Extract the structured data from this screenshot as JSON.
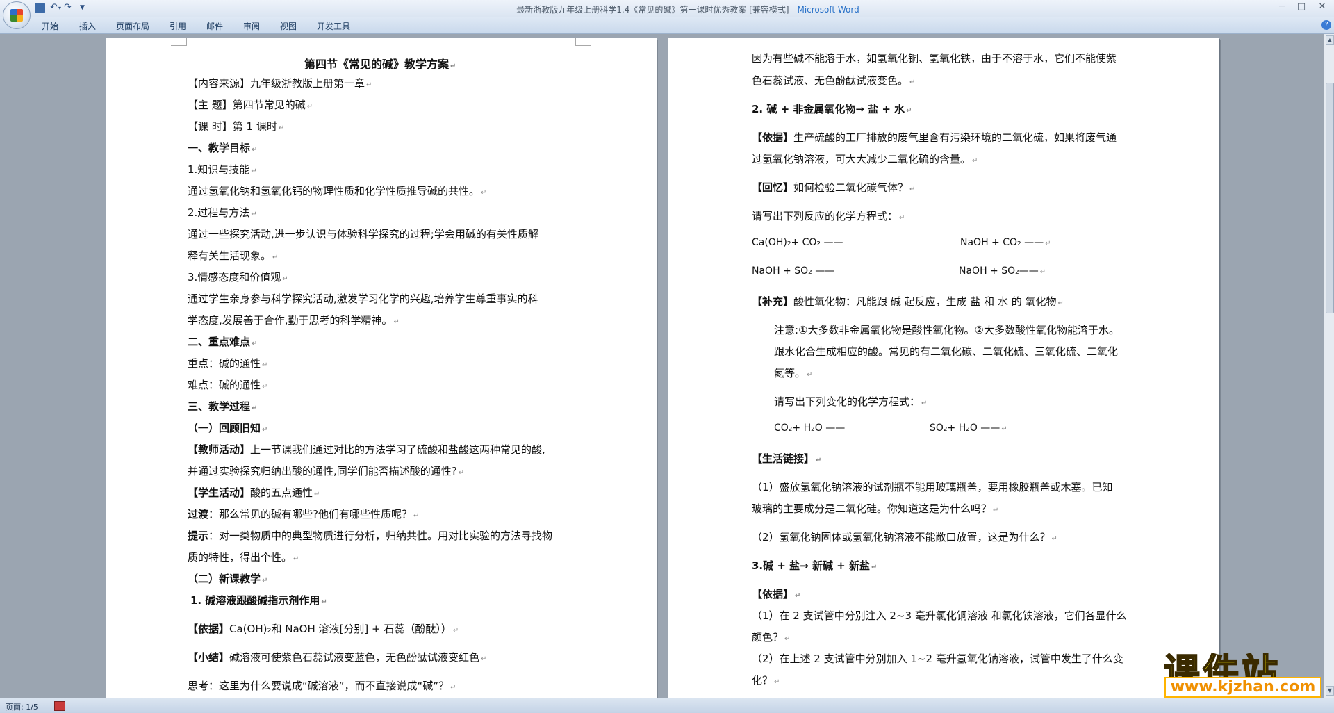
{
  "window": {
    "title": "最新浙教版九年级上册科学1.4《常见的碱》第一课时优秀教案 [兼容模式] - ",
    "app_name": "Microsoft Word",
    "min": "─",
    "max": "□",
    "close": "✕"
  },
  "qat": {
    "undo": "↶",
    "undo_drop": "▾",
    "redo": "↷",
    "more": "▼"
  },
  "ribbon": {
    "tabs": [
      "开始",
      "插入",
      "页面布局",
      "引用",
      "邮件",
      "审阅",
      "视图",
      "开发工具"
    ],
    "help": "?"
  },
  "paragraph_mark": "↵",
  "left_page": {
    "title": "第四节《常见的碱》教学方案",
    "source": "【内容来源】九年级浙教版上册第一章",
    "topic": "【主      题】第四节常见的碱",
    "period": "【课      时】第 1 课时",
    "s1": "一、教学目标",
    "s1_1": "1.知识与技能",
    "s1_1_text": "通过氢氧化钠和氢氧化钙的物理性质和化学性质推导碱的共性。",
    "s1_2": "2.过程与方法",
    "s1_2_text_a": "通过一些探究活动,进一步认识与体验科学探究的过程;学会用碱的有关性质解",
    "s1_2_text_b": "释有关生活现象。",
    "s1_3": "3.情感态度和价值观",
    "s1_3_text_a": "通过学生亲身参与科学探究活动,激发学习化学的兴趣,培养学生尊重事实的科",
    "s1_3_text_b": "学态度,发展善于合作,勤于思考的科学精神。",
    "s2": "二、重点难点",
    "key": "重点：碱的通性",
    "difficult": "难点：碱的通性",
    "s3": "三、教学过程",
    "s3_1": "（一）回顾旧知",
    "teacher_label": "【教师活动】",
    "teacher_text_a": "上一节课我们通过对比的方法学习了硫酸和盐酸这两种常见的酸,",
    "teacher_text_b": "并通过实验探究归纳出酸的通性,同学们能否描述酸的通性?",
    "student_label": "【学生活动】",
    "student_text": "酸的五点通性",
    "transition_label": "过渡",
    "transition_text": "：那么常见的碱有哪些?他们有哪些性质呢？",
    "hint_label": "提示",
    "hint_text_a": "：对一类物质中的典型物质进行分析，归纳共性。用对比实验的方法寻找物",
    "hint_text_b": "质的特性，得出个性。",
    "s3_2": "（二）新课教学",
    "item1_num": "1.",
    "item1_text": "碱溶液跟酸碱指示剂作用",
    "basis_label": "【依据】",
    "basis_text": "Ca(OH)₂和 NaOH 溶液[分别] + 石蕊（酚酞））",
    "summary_label": "【小结】",
    "summary_text": "碱溶液可使紫色石蕊试液变蓝色，无色酚酞试液变红色",
    "think_text": "思考：这里为什么要说成“碱溶液”，而不直接说成“碱”？"
  },
  "right_page": {
    "p1_a": "因为有些碱不能溶于水，如氢氧化铜、氢氧化铁，由于不溶于水，它们不能使紫",
    "p1_b": "色石蕊试液、无色酚酞试液变色。",
    "h2": "2. 碱 + 非金属氧化物→ 盐  +  水",
    "basis_label": "【依据】",
    "basis_text_a": "生产硫酸的工厂排放的废气里含有污染环境的二氧化硫，如果将废气通",
    "basis_text_b": "过氢氧化钠溶液，可大大减少二氧化硫的含量。",
    "recall_label": "【回忆】",
    "recall_text": "如何检验二氧化碳气体？",
    "write_eq": "请写出下列反应的化学方程式：",
    "eq1_a": "Ca(OH)₂+ CO₂ ——",
    "eq1_b": "NaOH + CO₂ ——",
    "eq2_a": "NaOH  +  SO₂ ——",
    "eq2_b": "NaOH + SO₂——",
    "supp_label": "【补充】",
    "supp_text_a": "酸性氧化物：凡能跟",
    "supp_u1": " 碱 ",
    "supp_text_b": "起反应，生成",
    "supp_u2": " 盐 ",
    "supp_text_c": "和",
    "supp_u3": " 水 ",
    "supp_text_d": "的",
    "supp_u4": " 氧化物",
    "note_a": "注意:①大多数非金属氧化物是酸性氧化物。②大多数酸性氧化物能溶于水。",
    "note_b": "跟水化合生成相应的酸。常见的有二氧化碳、二氧化硫、三氧化硫、二氧化",
    "note_c": "氮等。",
    "write_change": "请写出下列变化的化学方程式：",
    "eq3_a": "CO₂+ H₂O ——",
    "eq3_b": "SO₂+ H₂O ——",
    "life_label": "【生活链接】",
    "life1_a": "（1）盛放氢氧化钠溶液的试剂瓶不能用玻璃瓶盖，要用橡胶瓶盖或木塞。已知",
    "life1_b": "玻璃的主要成分是二氧化硅。你知道这是为什么吗？",
    "life2": "（2）氢氧化钠固体或氢氧化钠溶液不能敞口放置，这是为什么？",
    "h3": "3.碱  +  盐→ 新碱  +  新盐",
    "basis2_label": "【依据】",
    "e1_a": "（1）在 2 支试管中分别注入 2~3 毫升氯化铜溶液 和氯化铁溶液，它们各显什么",
    "e1_b": "颜色？",
    "e2_a": "（2）在上述 2 支试管中分别加入 1~2 毫升氢氧化钠溶液，试管中发生了什么变",
    "e2_b": "化？"
  },
  "status": {
    "page": "页面: 1/5"
  },
  "watermark": {
    "text": "课件站",
    "url": "www.kjzhan.com"
  }
}
